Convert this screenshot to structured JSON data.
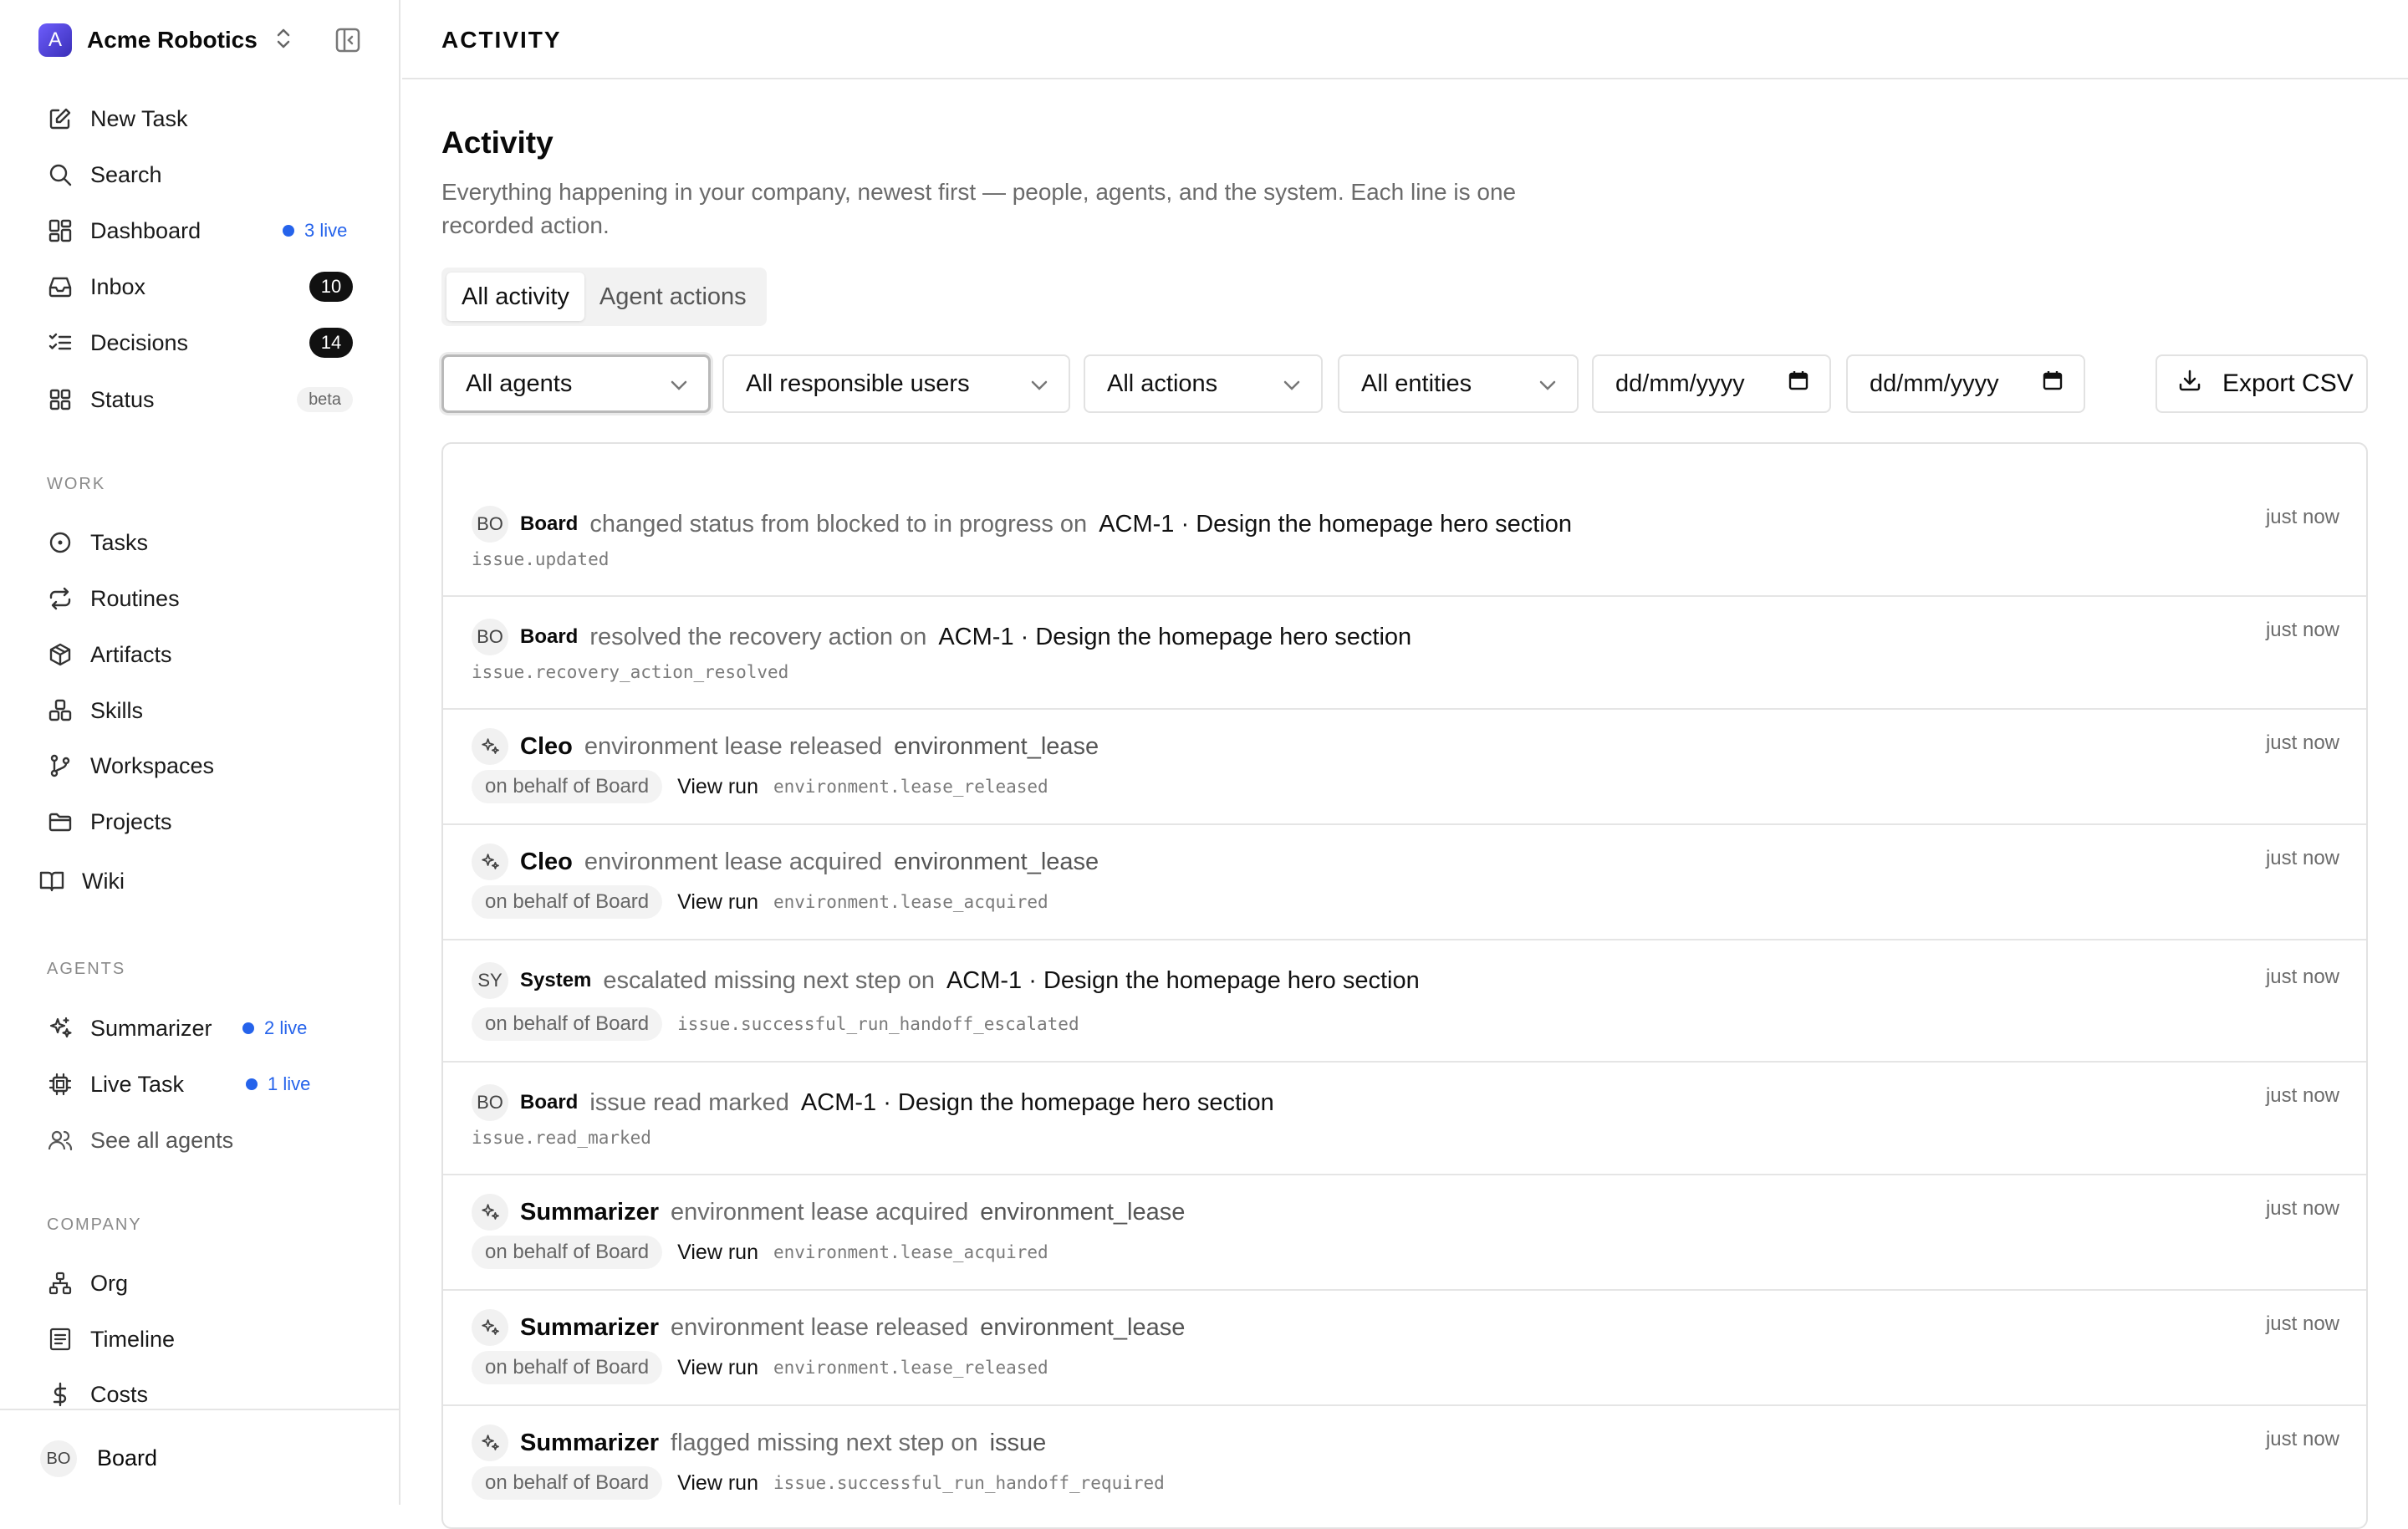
{
  "brand": {
    "logo_letter": "A",
    "name": "Acme Robotics"
  },
  "sidebar": {
    "main_items": [
      {
        "label": "New Task",
        "icon": "pencil-square-icon"
      },
      {
        "label": "Search",
        "icon": "search-icon"
      },
      {
        "label": "Dashboard",
        "icon": "dashboard-icon",
        "live": "3 live"
      },
      {
        "label": "Inbox",
        "icon": "inbox-icon",
        "count": "10"
      },
      {
        "label": "Decisions",
        "icon": "list-checks-icon",
        "count": "14"
      },
      {
        "label": "Status",
        "icon": "grid-icon",
        "badge": "beta"
      }
    ],
    "work_label": "WORK",
    "work_items": [
      {
        "label": "Tasks",
        "icon": "circle-dot-icon"
      },
      {
        "label": "Routines",
        "icon": "repeat-icon"
      },
      {
        "label": "Artifacts",
        "icon": "package-icon"
      },
      {
        "label": "Skills",
        "icon": "boxes-icon"
      },
      {
        "label": "Workspaces",
        "icon": "git-branch-icon"
      },
      {
        "label": "Projects",
        "icon": "folder-icon"
      },
      {
        "label": "Wiki",
        "icon": "book-icon"
      }
    ],
    "agents_label": "AGENTS",
    "agent_items": [
      {
        "label": "Summarizer",
        "icon": "sparkles-icon",
        "live": "2 live"
      },
      {
        "label": "Live Task",
        "icon": "cpu-icon",
        "live": "1 live"
      },
      {
        "label": "See all agents",
        "icon": "users-icon"
      }
    ],
    "company_label": "COMPANY",
    "company_items": [
      {
        "label": "Org",
        "icon": "org-chart-icon"
      },
      {
        "label": "Timeline",
        "icon": "timeline-icon"
      },
      {
        "label": "Costs",
        "icon": "dollar-icon"
      }
    ],
    "user": {
      "initials": "BO",
      "name": "Board"
    }
  },
  "topbar": {
    "title": "ACTIVITY"
  },
  "page": {
    "title": "Activity",
    "description": "Everything happening in your company, newest first — people, agents, and the system. Each line is one recorded action."
  },
  "tabs": [
    "All activity",
    "Agent actions"
  ],
  "filters": {
    "agents": "All agents",
    "users": "All responsible users",
    "actions": "All actions",
    "entities": "All entities",
    "date_from": "dd/mm/yyyy",
    "date_to": "dd/mm/yyyy",
    "export": "Export CSV"
  },
  "activity": [
    {
      "avatar": "BO",
      "actor": "Board",
      "verb": "changed status from blocked to in progress on",
      "target": "ACM-1 · Design the homepage hero section",
      "code": "issue.updated",
      "time": "just now"
    },
    {
      "avatar": "BO",
      "actor": "Board",
      "verb": "resolved the recovery action on",
      "target": "ACM-1 · Design the homepage hero section",
      "code": "issue.recovery_action_resolved",
      "time": "just now"
    },
    {
      "avatar": "",
      "actor": "Cleo",
      "verb": "environment lease released",
      "target": "environment_lease",
      "behalf": "on behalf of Board",
      "view_run": "View run",
      "code": "environment.lease_released",
      "time": "just now"
    },
    {
      "avatar": "",
      "actor": "Cleo",
      "verb": "environment lease acquired",
      "target": "environment_lease",
      "behalf": "on behalf of Board",
      "view_run": "View run",
      "code": "environment.lease_acquired",
      "time": "just now"
    },
    {
      "avatar": "SY",
      "actor": "System",
      "verb": "escalated missing next step on",
      "target": "ACM-1 · Design the homepage hero section",
      "behalf": "on behalf of Board",
      "code": "issue.successful_run_handoff_escalated",
      "time": "just now"
    },
    {
      "avatar": "BO",
      "actor": "Board",
      "verb": "issue read marked",
      "target": "ACM-1 · Design the homepage hero section",
      "code": "issue.read_marked",
      "time": "just now"
    },
    {
      "avatar": "",
      "actor": "Summarizer",
      "verb": "environment lease acquired",
      "target": "environment_lease",
      "behalf": "on behalf of Board",
      "view_run": "View run",
      "code": "environment.lease_acquired",
      "time": "just now"
    },
    {
      "avatar": "",
      "actor": "Summarizer",
      "verb": "environment lease released",
      "target": "environment_lease",
      "behalf": "on behalf of Board",
      "view_run": "View run",
      "code": "environment.lease_released",
      "time": "just now"
    },
    {
      "avatar": "",
      "actor": "Summarizer",
      "verb": "flagged missing next step on",
      "target": "issue",
      "behalf": "on behalf of Board",
      "view_run": "View run",
      "code": "issue.successful_run_handoff_required",
      "time": "just now"
    }
  ]
}
